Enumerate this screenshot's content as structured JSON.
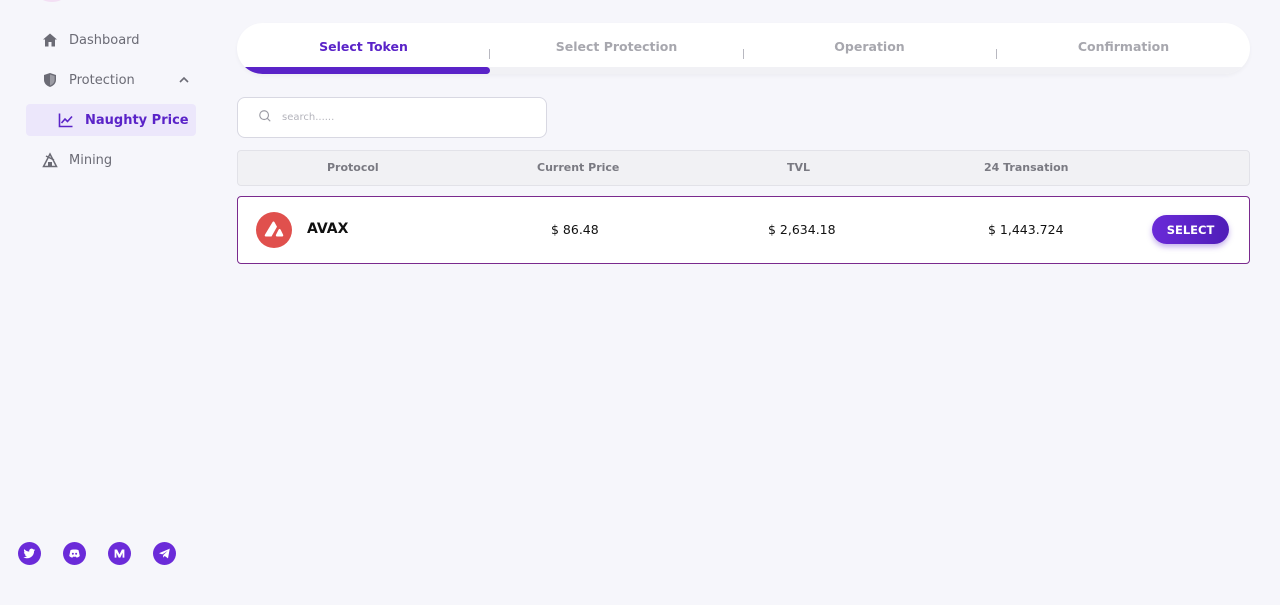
{
  "sidebar": {
    "items": [
      {
        "label": "Dashboard",
        "icon": "home-icon"
      },
      {
        "label": "Protection",
        "icon": "shield-icon"
      },
      {
        "label": "Naughty Price",
        "icon": "chart-line-icon"
      },
      {
        "label": "Mining",
        "icon": "mining-icon"
      }
    ],
    "socials": [
      "twitter-icon",
      "discord-icon",
      "medium-icon",
      "telegram-icon"
    ]
  },
  "stepper": {
    "steps": [
      "Select Token",
      "Select Protection",
      "Operation",
      "Confirmation"
    ],
    "active_index": 0,
    "progress": 0.25
  },
  "search": {
    "placeholder": "search......",
    "value": ""
  },
  "table": {
    "columns": [
      "Protocol",
      "Current Price",
      "TVL",
      "24 Transation"
    ],
    "rows": [
      {
        "protocol": "AVAX",
        "current_price": "$ 86.48",
        "tvl": "$ 2,634.18",
        "transactions": "$ 1,443.724",
        "action": "SELECT"
      }
    ]
  },
  "colors": {
    "accent": "#5a23c8",
    "avax_red": "#e0504d",
    "row_border": "#7a2a8e"
  }
}
